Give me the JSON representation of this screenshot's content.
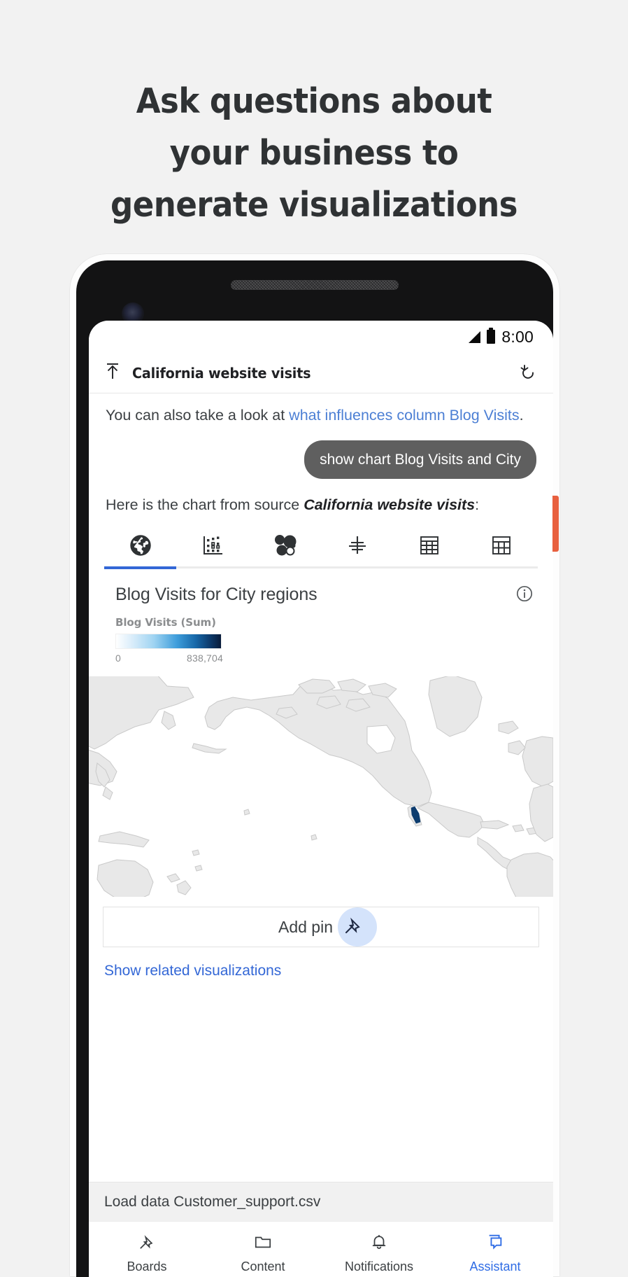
{
  "promo": {
    "headline_lines": [
      "Ask questions about",
      "your business to",
      "generate visualizations"
    ]
  },
  "status_bar": {
    "time": "8:00",
    "signal_icon": "signal-triangle-icon",
    "battery_icon": "battery-full-icon"
  },
  "app_header": {
    "back_icon": "upload-arrow-icon",
    "title": "California website visits",
    "refresh_icon": "undo-refresh-icon"
  },
  "conversation": {
    "bot_message_1": {
      "text_before": "You can also take a look at ",
      "link_text": "what influences column Blog Visits",
      "text_after": "."
    },
    "user_message": "show chart Blog Visits and City",
    "bot_message_2": {
      "text_before": "Here is the chart from source ",
      "source_name": "California website visits",
      "text_after": ":"
    }
  },
  "viz_tabs": [
    {
      "name": "geo-map",
      "icon": "globe-icon",
      "active": true
    },
    {
      "name": "scatter-plot",
      "icon": "scatter-plot-icon",
      "active": false
    },
    {
      "name": "bubble-chart",
      "icon": "bubble-cluster-icon",
      "active": false
    },
    {
      "name": "box-plot",
      "icon": "box-plot-icon",
      "active": false
    },
    {
      "name": "pivot-table",
      "icon": "pivot-table-icon",
      "active": false
    },
    {
      "name": "data-table",
      "icon": "table-grid-icon",
      "active": false
    }
  ],
  "chart_data": {
    "type": "heatmap",
    "subtype": "choropleth-world-map",
    "title": "Blog Visits for City regions",
    "info_icon": "info-circle-icon",
    "legend": {
      "label": "Blog Visits (Sum)",
      "min_label": "0",
      "max_label": "838,704",
      "min_value": 0,
      "max_value": 838704,
      "gradient_from": "#ffffff",
      "gradient_to": "#081b3a",
      "position": "top-left"
    },
    "measure": "Blog Visits (Sum)",
    "dimension": "City",
    "projection_center": "pacific",
    "land_fill": "#e8e8e8",
    "land_stroke": "#c9c9c9",
    "ocean_fill": "#ffffff",
    "highlighted_regions": [
      {
        "region": "California",
        "value": 838704,
        "color": "#081b3a"
      }
    ]
  },
  "actions": {
    "add_pin_label": "Add pin",
    "add_pin_icon": "pin-icon",
    "related_link": "Show related visualizations"
  },
  "load_data": {
    "text": "Load data Customer_support.csv"
  },
  "bottom_nav": [
    {
      "label": "Boards",
      "icon": "pin-icon",
      "active": false
    },
    {
      "label": "Content",
      "icon": "folder-icon",
      "active": false
    },
    {
      "label": "Notifications",
      "icon": "bell-icon",
      "active": false
    },
    {
      "label": "Assistant",
      "icon": "chat-bubbles-icon",
      "active": true
    }
  ],
  "colors": {
    "accent_blue": "#3367d6",
    "link_blue": "#4c7fd4",
    "bubble_gray": "#5f5f5f",
    "page_bg": "#f2f2f2",
    "side_button_orange": "#e8603f"
  }
}
